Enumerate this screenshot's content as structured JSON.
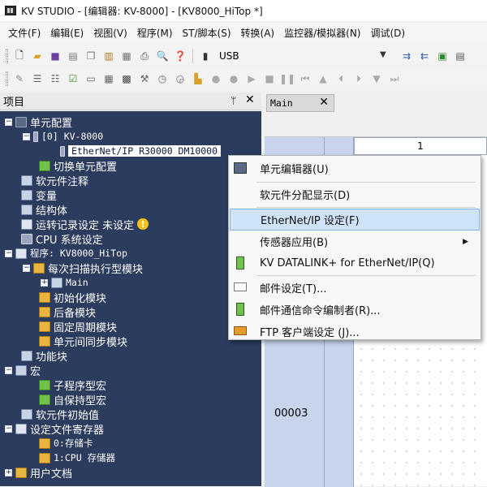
{
  "window": {
    "title": "KV STUDIO - [编辑器: KV-8000] - [KV8000_HiTop *]"
  },
  "menubar": [
    "文件(F)",
    "编辑(E)",
    "视图(V)",
    "程序(M)",
    "ST/脚本(S)",
    "转换(A)",
    "监控器/模拟器(N)",
    "调试(D)"
  ],
  "toolbar": {
    "connection": "USB"
  },
  "panel": {
    "title": "项目",
    "pin": "ᛘ",
    "close": "✕"
  },
  "tree": {
    "unit_config": "单元配置",
    "unit_slot": "[0]  KV-8000",
    "ethernet_ip": "EtherNet/IP   R30000  DM10000",
    "switch_unit": "切换单元配置",
    "device_comment": "软元件注释",
    "variable": "变量",
    "structure": "结构体",
    "run_record": "运转记录设定 未设定",
    "cpu_settings": "CPU 系统设定",
    "program": "程序: KV8000_HiTop",
    "every_scan": "每次扫描执行型模块",
    "main": "Main",
    "init_module": "初始化模块",
    "standby_module": "后备模块",
    "fixed_period": "固定周期模块",
    "interunit_sync": "单元间同步模块",
    "function_block": "功能块",
    "macro": "宏",
    "sub_macro": "子程序型宏",
    "self_hold_macro": "自保持型宏",
    "device_initial": "软元件初始值",
    "file_register": "设定文件寄存器",
    "storage_card": "0:存储卡",
    "cpu_memory": "1:CPU 存储器",
    "user_docs": "用户文档"
  },
  "editor": {
    "tab": "Main",
    "tab_close": "✕",
    "column": "1",
    "step": "00003"
  },
  "context_menu": {
    "items": [
      "单元编辑器(U)",
      "软元件分配显示(D)",
      "EtherNet/IP 设定(F)",
      "传感器应用(B)",
      "KV DATALINK+ for EtherNet/IP(Q)",
      "邮件设定(T)...",
      "邮件通信命令编制者(R)...",
      "FTP 客户端设定 (J)..."
    ]
  }
}
